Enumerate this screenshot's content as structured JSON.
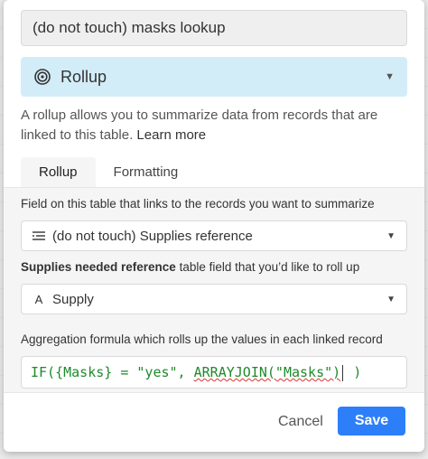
{
  "field_name": {
    "value": "(do not touch) masks lookup"
  },
  "field_type": {
    "label": "Rollup",
    "icon": "rollup-spiral-icon"
  },
  "description": {
    "text": "A rollup allows you to summarize data from records that are linked to this table.",
    "link": "Learn more"
  },
  "tabs": [
    {
      "label": "Rollup",
      "active": true
    },
    {
      "label": "Formatting",
      "active": false
    }
  ],
  "linked_field": {
    "label": "Field on this table that links to the records you want to summarize",
    "value": "(do not touch) Supplies reference",
    "icon": "linked-record-icon"
  },
  "rollup_field": {
    "label_bold": "Supplies needed reference",
    "label_rest": " table field that you’d like to roll up",
    "value": "Supply",
    "icon": "text-field-icon",
    "icon_glyph": "A"
  },
  "aggregation": {
    "label": "Aggregation formula which rolls up the values in each linked record",
    "formula_part1": "IF({Masks} = \"yes\", ",
    "formula_part2": "ARRAYJOIN(\"Masks\")",
    "formula_part3": " )"
  },
  "footer": {
    "cancel_label": "Cancel",
    "save_label": "Save"
  },
  "colors": {
    "accent": "#2d7ff9",
    "type_bg": "#d3edf8",
    "formula_text": "#1e8a2c"
  }
}
